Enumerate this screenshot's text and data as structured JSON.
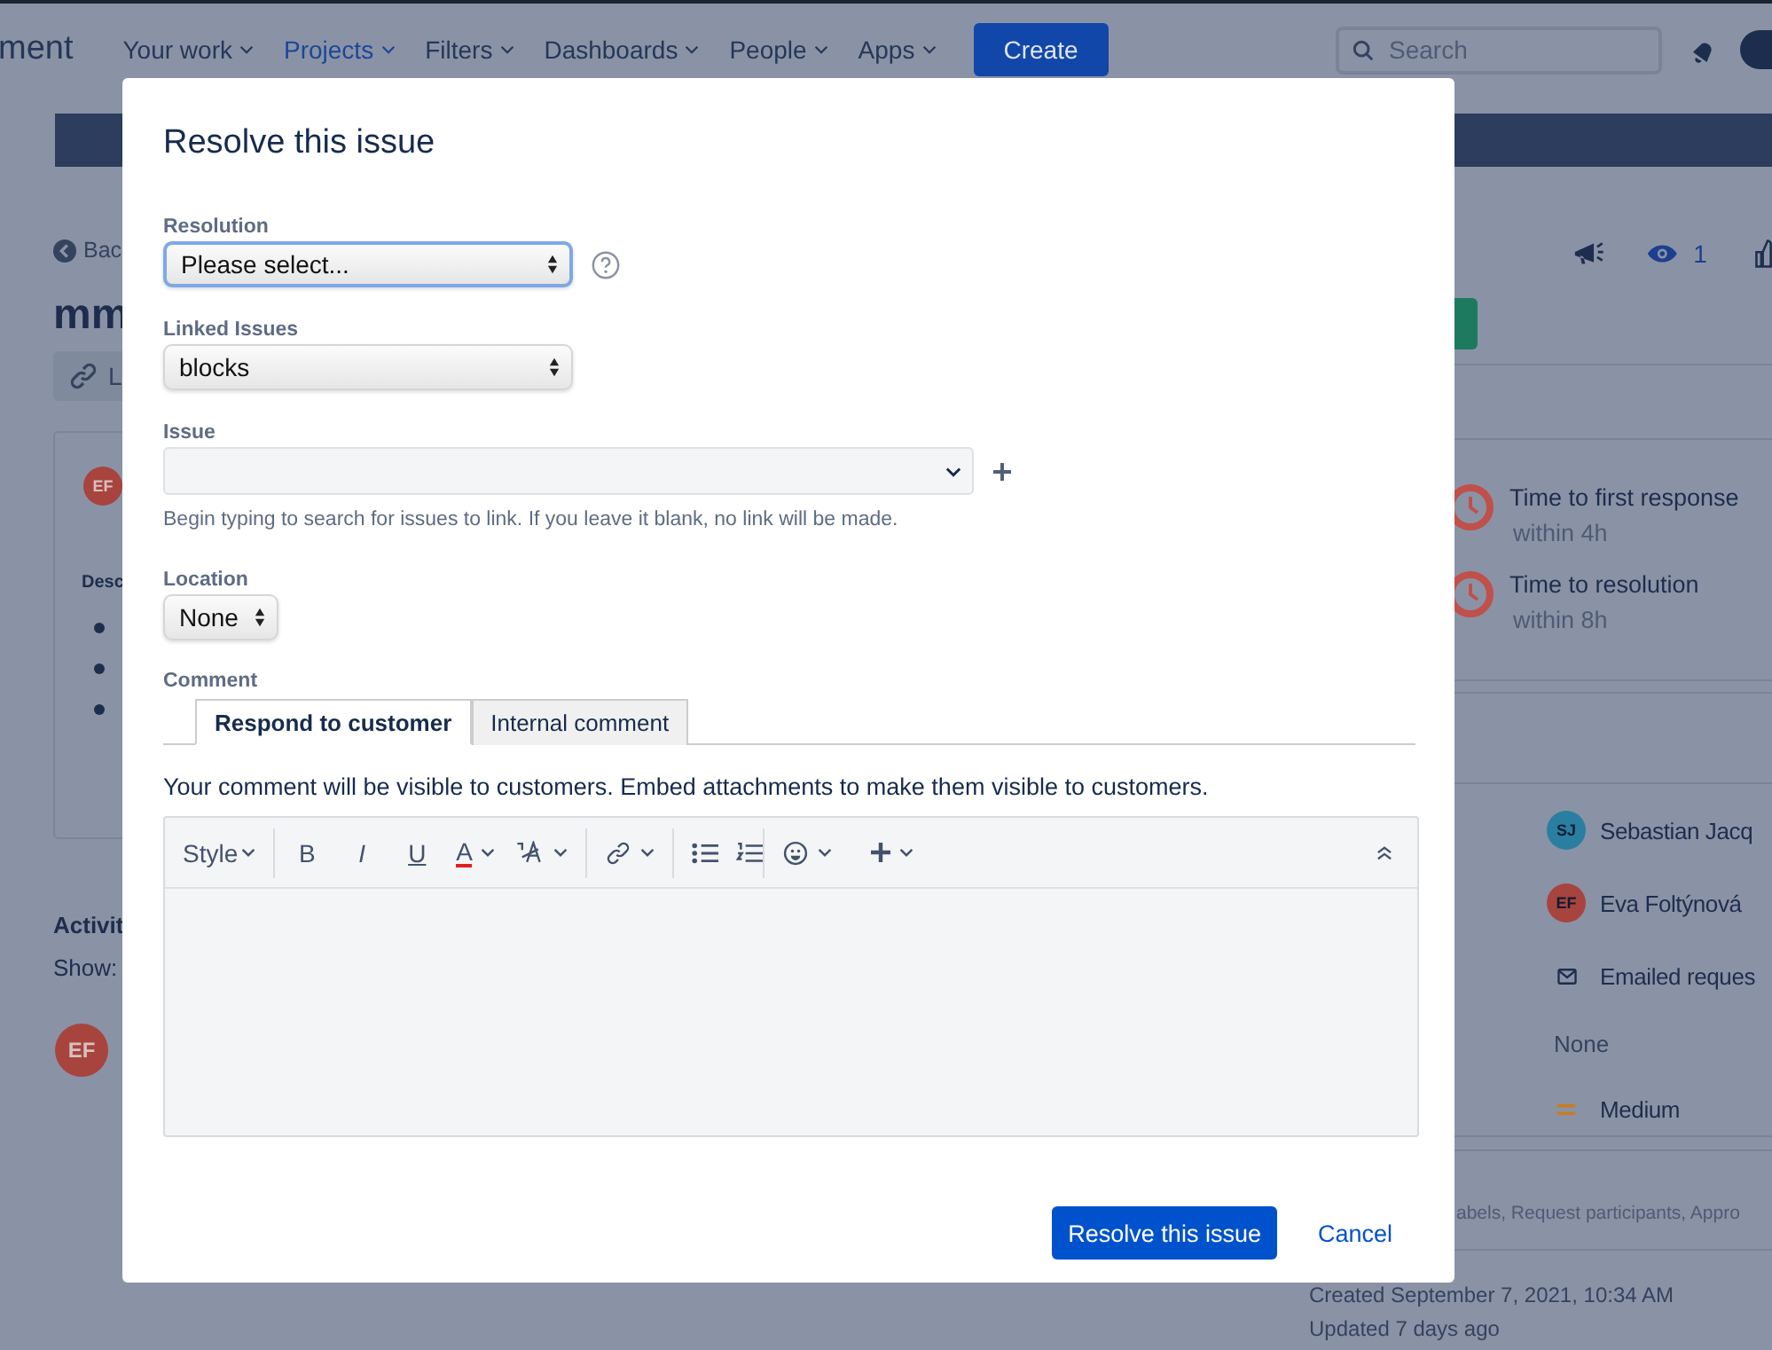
{
  "background": {
    "nav": {
      "brand": "ment",
      "items": [
        {
          "label": "Your work",
          "selected": false
        },
        {
          "label": "Projects",
          "selected": true
        },
        {
          "label": "Filters",
          "selected": false
        },
        {
          "label": "Dashboards",
          "selected": false
        },
        {
          "label": "People",
          "selected": false
        },
        {
          "label": "Apps",
          "selected": false
        }
      ],
      "create": "Create",
      "search": {
        "placeholder": "Search"
      }
    },
    "left": {
      "back": "Bac",
      "title": "mm",
      "link_button": "L",
      "card_avatar": "EF",
      "card_heading": "Desc",
      "activity": "Activit",
      "show": "Show:",
      "comment_avatar": "EF"
    },
    "right": {
      "watchers": "1",
      "sla": [
        {
          "title": "Time to first response",
          "target": "within 4h"
        },
        {
          "title": "Time to resolution",
          "target": "within 8h"
        }
      ],
      "people": [
        {
          "kind": "avatar",
          "initials": "SJ",
          "name": "Sebastian Jacq",
          "color": "#2a7fa0"
        },
        {
          "kind": "avatar",
          "initials": "EF",
          "name": "Eva Foltýnová",
          "color": "#a8443e"
        },
        {
          "kind": "mail",
          "name": "Emailed reques"
        }
      ],
      "none": "None",
      "priority": "Medium",
      "more_fields": "abels, Request participants, Appro",
      "created": "Created September 7, 2021, 10:34 AM",
      "updated": "Updated 7 days ago"
    }
  },
  "dialog": {
    "title": "Resolve this issue",
    "resolution": {
      "label": "Resolution",
      "value": "Please select...",
      "focused": true
    },
    "linked": {
      "label": "Linked Issues",
      "value": "blocks",
      "focused": false
    },
    "issue": {
      "label": "Issue",
      "help": "Begin typing to search for issues to link. If you leave it blank, no link will be made."
    },
    "location": {
      "label": "Location",
      "value": "None",
      "focused": false
    },
    "comment": {
      "label": "Comment",
      "tabs": [
        {
          "label": "Respond to customer",
          "selected": true
        },
        {
          "label": "Internal comment",
          "selected": false
        }
      ],
      "notice": "Your comment will be visible to customers. Embed attachments to make them visible to customers.",
      "toolbar": {
        "style": "Style",
        "formats": [
          "B",
          "I",
          "U"
        ],
        "color_letter": "A"
      }
    },
    "buttons": {
      "primary": "Resolve this issue",
      "cancel": "Cancel"
    }
  }
}
